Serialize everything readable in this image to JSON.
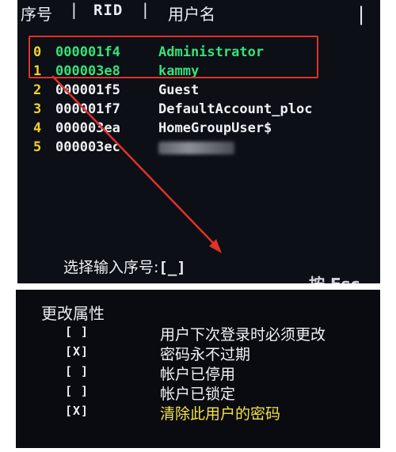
{
  "user_list": {
    "headers": {
      "seq": "序号",
      "rid": "RID",
      "name": "用户名",
      "separator": "|"
    },
    "rows": [
      {
        "index": "0",
        "rid": "000001f4",
        "name": "Administrator",
        "color": "#37e07a"
      },
      {
        "index": "1",
        "rid": "000003e8",
        "name": "kammy",
        "color": "#37e07a"
      },
      {
        "index": "2",
        "rid": "000001f5",
        "name": "Guest",
        "color": "#eef0f2"
      },
      {
        "index": "3",
        "rid": "000001f7",
        "name": "DefaultAccount_ploc",
        "color": "#eef0f2"
      },
      {
        "index": "4",
        "rid": "000003ea",
        "name": "HomeGroupUser$",
        "color": "#eef0f2"
      },
      {
        "index": "5",
        "rid": "000003ec",
        "name": "",
        "color": "#eef0f2"
      }
    ],
    "prompt": "选择输入序号:",
    "cursor": "[_]",
    "cutoff_text": "按 Esc",
    "highlight_color": "#e0312b"
  },
  "attributes": {
    "title": "更改属性",
    "items": [
      {
        "box": "[ ]",
        "label": "用户下次登录时必须更改",
        "color": "#f0f2f4"
      },
      {
        "box": "[X]",
        "label": "密码永不过期",
        "color": "#f0f2f4"
      },
      {
        "box": "[ ]",
        "label": "帐户已停用",
        "color": "#f0f2f4"
      },
      {
        "box": "[ ]",
        "label": "帐户已锁定",
        "color": "#f0f2f4"
      },
      {
        "box": "[X]",
        "label": "清除此用户的密码",
        "color": "#f4e24a"
      }
    ]
  }
}
